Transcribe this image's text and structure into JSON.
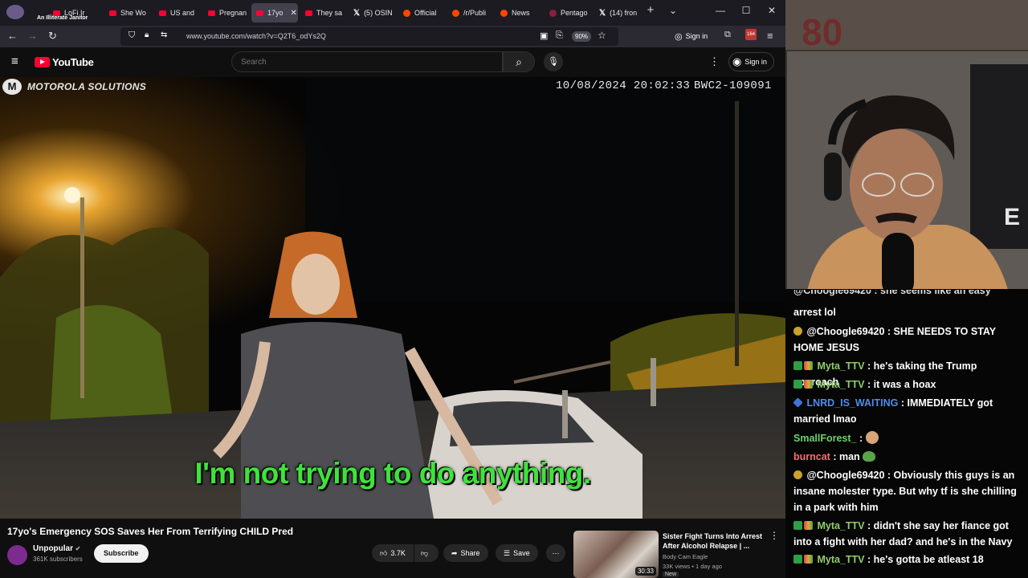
{
  "browser": {
    "profile_label": "An Illiterate Janitor",
    "tabs": [
      {
        "label": "LoFi Ir",
        "icon": "youtube-icon"
      },
      {
        "label": "She Wo",
        "icon": "youtube-icon"
      },
      {
        "label": "US and",
        "icon": "youtube-icon"
      },
      {
        "label": "Pregnan",
        "icon": "youtube-icon"
      },
      {
        "label": "17yo",
        "icon": "youtube-icon",
        "active": true
      },
      {
        "label": "They sa",
        "icon": "youtube-icon"
      },
      {
        "label": "(5) OSIN",
        "icon": "x-icon"
      },
      {
        "label": "Official",
        "icon": "reddit-icon"
      },
      {
        "label": "/r/Publi",
        "icon": "reddit-icon"
      },
      {
        "label": "News",
        "icon": "reddit-icon"
      },
      {
        "label": "Pentago",
        "icon": "pentagon-icon"
      },
      {
        "label": "(14) fron",
        "icon": "x-icon"
      }
    ],
    "url": "www.youtube.com/watch?v=Q2T6_odYs2Q",
    "zoom": "90%",
    "signin_label": "Sign in",
    "extension_badge": "164"
  },
  "youtube": {
    "logo_text": "YouTube",
    "search_placeholder": "Search",
    "signin_label": "Sign in"
  },
  "video": {
    "brand": "MOTOROLA SOLUTIONS",
    "timestamp": "10/08/2024 20:02:33",
    "camera_id": "BWC2-109091",
    "caption": "I'm not trying to do anything."
  },
  "below_video": {
    "title": "17yo's Emergency SOS Saves Her From Terrifying CHILD Pred",
    "channel": "Unpopular",
    "subscribers": "361K subscribers",
    "subscribe_label": "Subscribe",
    "likes": "3.7K",
    "share_label": "Share",
    "save_label": "Save"
  },
  "recommended": {
    "title": "Sister Fight Turns Into Arrest After Alcohol Relapse | ...",
    "channel": "Body Cam Eagle",
    "meta": "33K views • 1 day ago",
    "badge": "New",
    "duration": "30:33"
  },
  "chat": {
    "messages": [
      {
        "user": "",
        "user_color": "#ffffff",
        "text": "arrest lol",
        "partial_top": "@Choogle69420 : she seems like an easy"
      },
      {
        "user": "@Choogle69420",
        "user_color": "#ffffff",
        "text": "SHE NEEDS TO STAY HOME JESUS",
        "badges": [
          "star"
        ]
      },
      {
        "user": "Myta_TTV",
        "user_color": "#8fce6a",
        "text": "he's taking the Trump approach",
        "badges": [
          "check",
          "multi"
        ]
      },
      {
        "user": "Myta_TTV",
        "user_color": "#8fce6a",
        "text": "it was a hoax",
        "badges": [
          "check",
          "multi"
        ]
      },
      {
        "user": "LNRD_IS_WAITING",
        "user_color": "#4f8de8",
        "text": "IMMEDIATELY got married lmao",
        "badges": [
          "diamond"
        ]
      },
      {
        "user": "SmallForest_",
        "user_color": "#6fd06a",
        "text": "",
        "emote": "thinking-emote",
        "badges": []
      },
      {
        "user": "burncat",
        "user_color": "#ff6b6b",
        "text": "man",
        "emote": "frog-emote",
        "badges": []
      },
      {
        "user": "@Choogle69420",
        "user_color": "#ffffff",
        "text": "Obviously this guys is an insane molester type. But why tf is she chilling in a park with him",
        "badges": [
          "star"
        ]
      },
      {
        "user": "Myta_TTV",
        "user_color": "#8fce6a",
        "text": "didn't she say her fiance got into a fight with her dad? and he's in the Navy",
        "badges": [
          "check",
          "multi"
        ]
      },
      {
        "user": "Myta_TTV",
        "user_color": "#8fce6a",
        "text": "he's gotta be atleast 18",
        "badges": [
          "check",
          "multi"
        ]
      }
    ]
  },
  "colors": {
    "youtube_red": "#ff0033",
    "caption_green": "#3fe23c",
    "page_bg": "#0f0f0f"
  }
}
